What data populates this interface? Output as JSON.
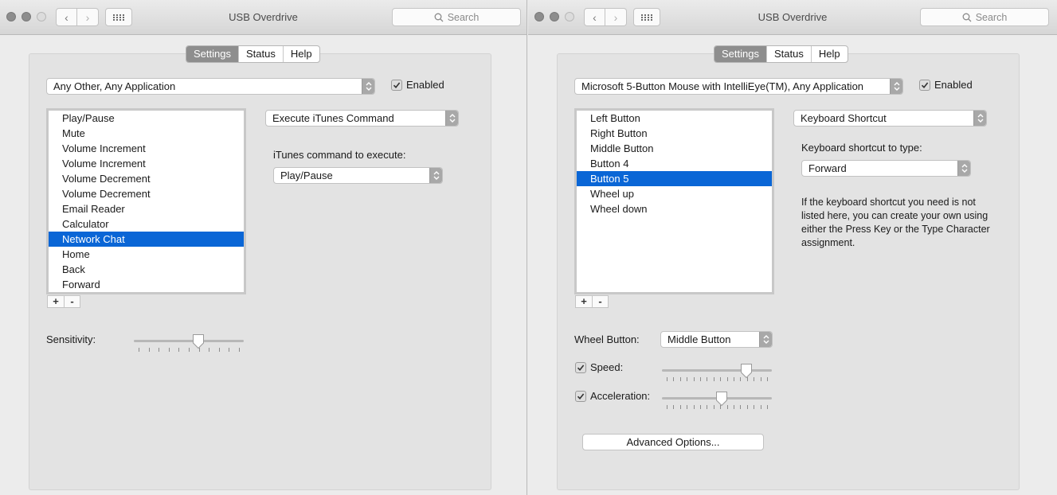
{
  "left": {
    "title": "USB Overdrive",
    "search_placeholder": "Search",
    "tabs": [
      "Settings",
      "Status",
      "Help"
    ],
    "device_popup": "Any Other, Any Application",
    "enabled_label": "Enabled",
    "enabled_checked": true,
    "buttons_list": [
      "Play/Pause",
      "Mute",
      "Volume Increment",
      "Volume Increment",
      "Volume Decrement",
      "Volume Decrement",
      "Email Reader",
      "Calculator",
      "Network Chat",
      "Home",
      "Back",
      "Forward"
    ],
    "selected_index": 8,
    "action_popup": "Execute iTunes Command",
    "itunes_label": "iTunes command to execute:",
    "itunes_popup": "Play/Pause",
    "add_label": "+",
    "remove_label": "-",
    "sensitivity_label": "Sensitivity:",
    "sensitivity_value": 0.6
  },
  "right": {
    "title": "USB Overdrive",
    "search_placeholder": "Search",
    "tabs": [
      "Settings",
      "Status",
      "Help"
    ],
    "device_popup": "Microsoft 5-Button Mouse with IntelliEye(TM), Any Application",
    "enabled_label": "Enabled",
    "enabled_checked": true,
    "buttons_list": [
      "Left Button",
      "Right Button",
      "Middle Button",
      "Button 4",
      "Button 5",
      "Wheel up",
      "Wheel down"
    ],
    "selected_index": 4,
    "action_popup": "Keyboard Shortcut",
    "shortcut_label": "Keyboard shortcut to type:",
    "shortcut_popup": "Forward",
    "info_text": "If the keyboard shortcut you need is not listed here, you can create your own using either the Press Key or the Type Character assignment.",
    "add_label": "+",
    "remove_label": "-",
    "wheel_button_label": "Wheel Button:",
    "wheel_button_popup": "Middle Button",
    "speed_label": "Speed:",
    "speed_checked": true,
    "speed_value": 0.8,
    "acceleration_label": "Acceleration:",
    "acceleration_checked": true,
    "acceleration_value": 0.55,
    "advanced_button": "Advanced Options..."
  },
  "colors": {
    "selection": "#0a66d6",
    "segment_selected": "#8e8e8e"
  }
}
